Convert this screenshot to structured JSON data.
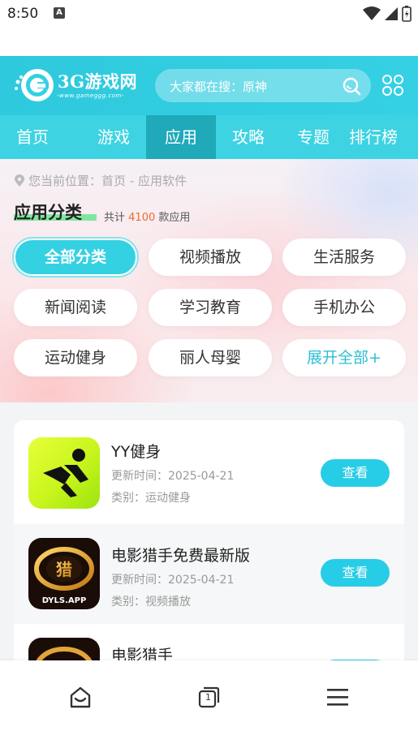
{
  "status_bar": {
    "time": "8:50",
    "notification_badge": "A"
  },
  "header": {
    "logo_text": "3G游戏网",
    "logo_url": "-www.gameggg.com-",
    "search_text": "大家都在搜：原神"
  },
  "nav": {
    "items": [
      {
        "label": "首页",
        "active": false
      },
      {
        "label": "游戏",
        "active": false
      },
      {
        "label": "应用",
        "active": true
      },
      {
        "label": "攻略",
        "active": false
      },
      {
        "label": "专题",
        "active": false
      },
      {
        "label": "排行榜",
        "active": false
      }
    ]
  },
  "breadcrumb": {
    "text": "您当前位置：首页 - 应用软件"
  },
  "category": {
    "title": "应用分类",
    "count_prefix": "共计",
    "count": "4100",
    "count_suffix": "款应用",
    "chips": [
      {
        "label": "全部分类",
        "active": true
      },
      {
        "label": "视频播放",
        "active": false
      },
      {
        "label": "生活服务",
        "active": false
      },
      {
        "label": "新闻阅读",
        "active": false
      },
      {
        "label": "学习教育",
        "active": false
      },
      {
        "label": "手机办公",
        "active": false
      },
      {
        "label": "运动健身",
        "active": false
      },
      {
        "label": "丽人母婴",
        "active": false
      },
      {
        "label": "展开全部+",
        "active": false
      }
    ]
  },
  "apps": [
    {
      "name": "YY健身",
      "update": "更新时间：2025-04-21",
      "category": "类别：运动健身",
      "button": "查看"
    },
    {
      "name": "电影猎手免费最新版",
      "update": "更新时间：2025-04-21",
      "category": "类别：视频播放",
      "button": "查看",
      "icon_text": "DYLS.APP",
      "icon_glyph": "猎"
    },
    {
      "name": "电影猎手"
    }
  ],
  "bottom_bar": {
    "tab_count": "1"
  },
  "colors": {
    "brand": "#35d0e4",
    "nav_active": "#1fa9b9",
    "button": "#27cde6",
    "count": "#f06a2e"
  }
}
